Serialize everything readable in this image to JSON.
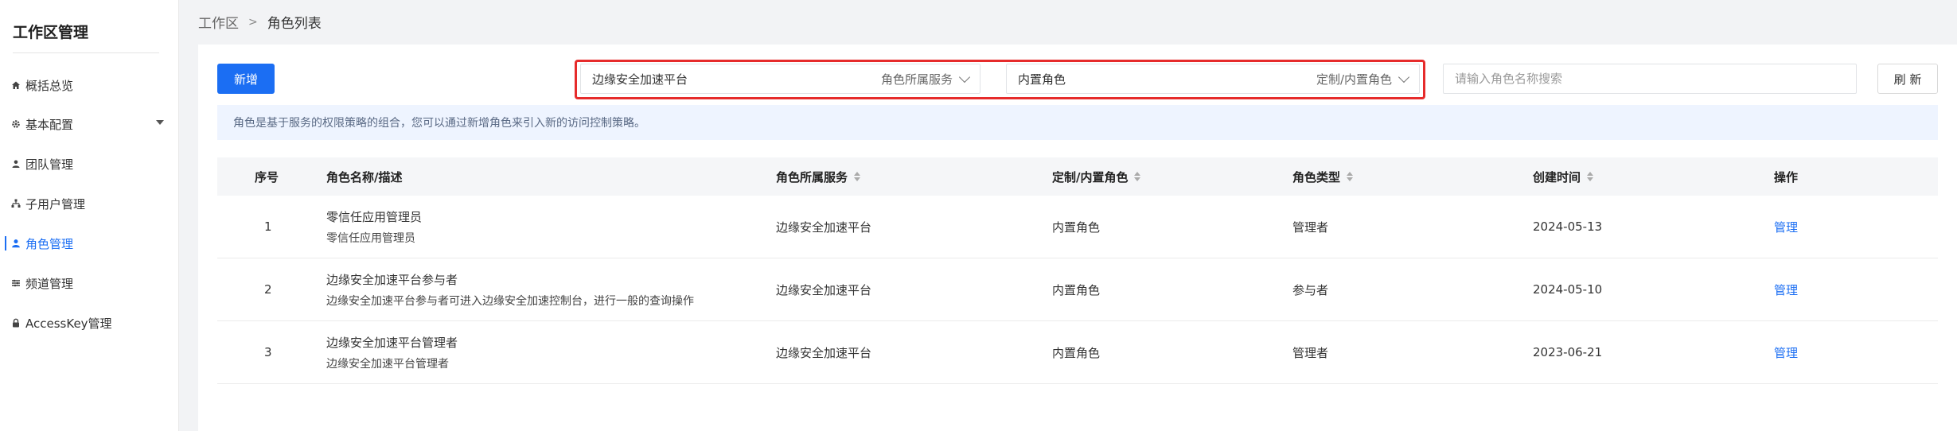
{
  "sidebar": {
    "title": "工作区管理",
    "items": [
      {
        "label": "概括总览",
        "icon": "home-icon"
      },
      {
        "label": "基本配置",
        "icon": "gear-icon"
      },
      {
        "label": "团队管理",
        "icon": "team-icon"
      },
      {
        "label": "子用户管理",
        "icon": "sub-user-icon"
      },
      {
        "label": "角色管理",
        "icon": "user-icon",
        "active": true
      },
      {
        "label": "频道管理",
        "icon": "channel-icon"
      },
      {
        "label": "AccessKey管理",
        "icon": "lock-icon"
      }
    ]
  },
  "breadcrumb": {
    "root": "工作区",
    "current": "角色列表"
  },
  "toolbar": {
    "add_label": "新增",
    "service_select": {
      "value": "边缘安全加速平台",
      "label": "角色所属服务"
    },
    "role_kind_select": {
      "value": "内置角色",
      "label": "定制/内置角色"
    },
    "search_placeholder": "请输入角色名称搜索",
    "refresh_label": "刷 新"
  },
  "notice": "角色是基于服务的权限策略的组合，您可以通过新增角色来引入新的访问控制策略。",
  "table": {
    "columns": [
      "序号",
      "角色名称/描述",
      "角色所属服务",
      "定制/内置角色",
      "角色类型",
      "创建时间",
      "操作"
    ],
    "rows": [
      {
        "index": "1",
        "name": "零信任应用管理员",
        "desc": "零信任应用管理员",
        "service": "边缘安全加速平台",
        "kind": "内置角色",
        "type": "管理者",
        "created": "2024-05-13",
        "action": "管理"
      },
      {
        "index": "2",
        "name": "边缘安全加速平台参与者",
        "desc": "边缘安全加速平台参与者可进入边缘安全加速控制台，进行一般的查询操作",
        "service": "边缘安全加速平台",
        "kind": "内置角色",
        "type": "参与者",
        "created": "2024-05-10",
        "action": "管理"
      },
      {
        "index": "3",
        "name": "边缘安全加速平台管理者",
        "desc": "边缘安全加速平台管理者",
        "service": "边缘安全加速平台",
        "kind": "内置角色",
        "type": "管理者",
        "created": "2023-06-21",
        "action": "管理"
      }
    ]
  },
  "colors": {
    "accent": "#1b6ef3",
    "highlight_border": "#e62b2b",
    "notice_bg": "#eef4ff"
  }
}
